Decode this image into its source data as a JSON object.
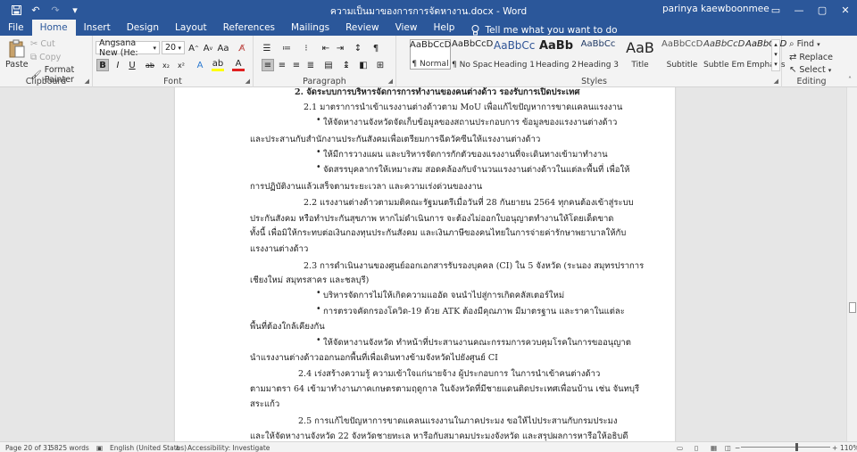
{
  "window": {
    "title": "ความเป็นมาของการการจัดหางาน.docx - Word",
    "user": "parinya kaewboonmee",
    "qat": {
      "save_icon": "save-icon",
      "undo_icon": "undo-icon",
      "redo_icon": "redo-icon",
      "customize_icon": "dropdown-icon"
    },
    "buttons": {
      "ribbon_options": "▭",
      "minimize": "—",
      "maximize": "▢",
      "close": "✕"
    }
  },
  "tabs": [
    "File",
    "Home",
    "Insert",
    "Design",
    "Layout",
    "References",
    "Mailings",
    "Review",
    "View",
    "Help"
  ],
  "active_tab": "Home",
  "tell_me": "Tell me what you want to do",
  "ribbon": {
    "clipboard": {
      "label": "Clipboard",
      "paste": "Paste",
      "cut": "Cut",
      "copy": "Copy",
      "format_painter": "Format Painter"
    },
    "font": {
      "label": "Font",
      "font_name": "Angsana New (He:",
      "font_size": "20"
    },
    "paragraph": {
      "label": "Paragraph"
    },
    "styles": {
      "label": "Styles",
      "items": [
        {
          "preview": "AaBbCcDd",
          "name": "¶ Normal"
        },
        {
          "preview": "AaBbCcDd",
          "name": "¶ No Spac..."
        },
        {
          "preview": "AaBbCc",
          "name": "Heading 1"
        },
        {
          "preview": "AaBb",
          "name": "Heading 2"
        },
        {
          "preview": "AaBbCc",
          "name": "Heading 3"
        },
        {
          "preview": "AaB",
          "name": "Title"
        },
        {
          "preview": "AaBbCcD",
          "name": "Subtitle"
        },
        {
          "preview": "AaBbCcDd",
          "name": "Subtle Em..."
        },
        {
          "preview": "AaBbCcDd",
          "name": "Emphasis"
        }
      ]
    },
    "editing": {
      "label": "Editing",
      "find": "Find",
      "replace": "Replace",
      "select": "Select"
    }
  },
  "document": {
    "lines": [
      "2. จัดระบบการบริหารจัดการการทำงานของคนต่างด้าว รองรับการเปิดประเทศ",
      "2.1 มาตราการนำเข้าแรงงานต่างด้าวตาม MoU เพื่อแก้ไขปัญหาการขาดแคลนแรงงาน",
      "ให้จัดหางานจังหวัดจัดเก็บข้อมูลของสถานประกอบการ ข้อมูลของแรงงานต่างด้าว",
      "และประสานกับสำนักงานประกันสังคมเพื่อเตรียมการฉีดวัคซีนให้แรงงานต่างด้าว",
      "ให้มีการวางแผน และบริหารจัดการกักตัวของแรงงานที่จะเดินทางเข้ามาทำงาน",
      "จัดสรรบุคลากรให้เหมาะสม สอดคล้องกับจำนวนแรงงานต่างด้าวในแต่ละพื้นที่ เพื่อให้",
      "การปฏิบัติงานแล้วเสร็จตามระยะเวลา และความเร่งด่วนของงาน",
      "2.2 แรงงานต่างด้าวตามมติคณะรัฐมนตรีเมื่อวันที่ 28 กันยายน 2564 ทุกคนต้องเข้าสู่ระบบ",
      "ประกันสังคม หรือทำประกันสุขภาพ หากไม่ดำเนินการ จะต้องไม่ออกใบอนุญาตทำงานให้โดยเด็ดขาด",
      "ทั้งนี้ เพื่อมิให้กระทบต่อเงินกองทุนประกันสังคม และเงินภาษีของคนไทยในการจ่ายค่ารักษาพยาบาลให้กับ",
      "แรงงานต่างด้าว",
      "2.3 การดำเนินงานของศูนย์ออกเอกสารรับรองบุคคล (CI) ใน 5 จังหวัด (ระนอง สมุทรปราการ",
      "เชียงใหม่ สมุทรสาคร และชลบุรี)",
      "บริหารจัดการไม่ให้เกิดความแออัด จนนำไปสู่การเกิดคลัสเตอร์ใหม่",
      "การตรวจคัดกรองโควิด-19 ด้วย ATK ต้องมีคุณภาพ มีมาตรฐาน และราคาในแต่ละ",
      "พื้นที่ต้องใกล้เคียงกัน",
      "ให้จัดหางานจังหวัด ทำหน้าที่ประสานงานคณะกรรมการควบคุมโรคในการขออนุญาต",
      "นำแรงงานต่างด้าวออกนอกพื้นที่เพื่อเดินทางข้ามจังหวัดไปยังศูนย์ CI",
      "2.4 เร่งสร้างความรู้ ความเข้าใจแก่นายจ้าง ผู้ประกอบการ ในการนำเข้าคนต่างด้าว",
      "ตามมาตรา 64 เข้ามาทำงานภาคเกษตรตามฤดูกาล ในจังหวัดที่มีชายแดนติดประเทศเพื่อนบ้าน เช่น จันทบุรี",
      "สระแก้ว",
      "2.5 การแก้ไขปัญหาการขาดแคลนแรงงานในภาคประมง ขอให้ไปประสานกับกรมประมง",
      "และให้จัดหางานจังหวัด 22 จังหวัดชายทะเล หารือกับสมาคมประมงจังหวัด และสรุปผลการหารือให้อธิบดี"
    ]
  },
  "status": {
    "page": "Page 20 of 31",
    "words": "5825 words",
    "language": "English (United States)",
    "accessibility": "Accessibility: Investigate",
    "zoom": "110%"
  }
}
